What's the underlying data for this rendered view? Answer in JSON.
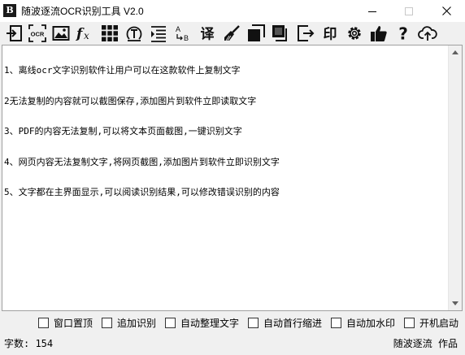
{
  "window": {
    "title": "随波逐流OCR识别工具 V2.0",
    "app_icon_glyph": "B",
    "controls": [
      "minimize-icon",
      "maximize-icon",
      "close-icon"
    ]
  },
  "toolbar": {
    "buttons": [
      {
        "icon": "import-icon"
      },
      {
        "icon": "ocr-icon",
        "label": "OCR"
      },
      {
        "icon": "image-icon"
      },
      {
        "icon": "formula-icon",
        "label": "fx"
      },
      {
        "icon": "grid-icon"
      },
      {
        "icon": "text-recognize-icon"
      },
      {
        "icon": "align-icon"
      },
      {
        "icon": "letter-convert-icon",
        "label_top": "A",
        "label_bottom": "B"
      },
      {
        "icon": "translate-icon",
        "label": "译"
      },
      {
        "icon": "broom-icon"
      },
      {
        "icon": "copy-icon"
      },
      {
        "icon": "paste-icon"
      },
      {
        "icon": "export-icon"
      },
      {
        "icon": "stamp-icon",
        "label": "印"
      },
      {
        "icon": "gear-icon"
      },
      {
        "icon": "thumbs-up-icon"
      },
      {
        "icon": "help-icon",
        "label": "?"
      },
      {
        "icon": "cloud-upload-icon"
      }
    ]
  },
  "editor": {
    "lines": [
      "1、离线ocr文字识别软件让用户可以在这款软件上复制文字",
      "2无法复制的内容就可以截图保存,添加图片到软件立即读取文字",
      "3、PDF的内容无法复制,可以将文本页面截图,一键识别文字",
      "4、网页内容无法复制文字,将网页截图,添加图片到软件立即识别文字",
      "5、文字都在主界面显示,可以阅读识别结果,可以修改错误识别的内容"
    ]
  },
  "options": [
    {
      "label": "窗口置顶",
      "checked": false
    },
    {
      "label": "追加识别",
      "checked": false
    },
    {
      "label": "自动整理文字",
      "checked": false
    },
    {
      "label": "自动首行缩进",
      "checked": false
    },
    {
      "label": "自动加水印",
      "checked": false
    },
    {
      "label": "开机启动",
      "checked": false
    }
  ],
  "status": {
    "char_count_label": "字数: 154",
    "author": "随波逐流 作品"
  }
}
